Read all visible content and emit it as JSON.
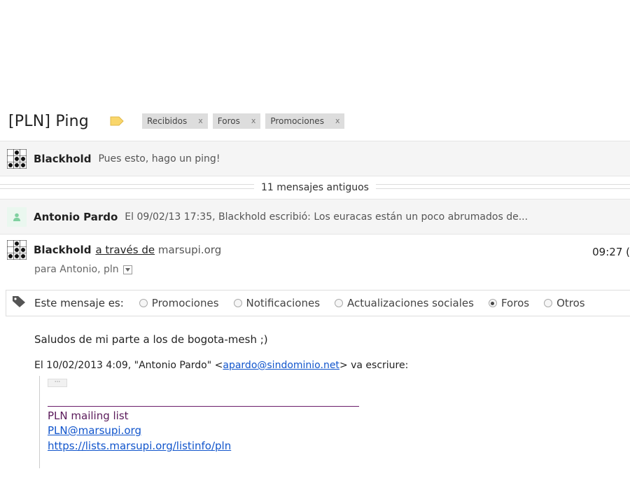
{
  "subject": {
    "title": "[PLN] Ping",
    "label_color": "#f9d66b",
    "labels": [
      {
        "name": "Recibidos",
        "remove": "x"
      },
      {
        "name": "Foros",
        "remove": "x"
      },
      {
        "name": "Promociones",
        "remove": "x"
      }
    ]
  },
  "messages": {
    "first": {
      "sender": "Blackhold",
      "snippet": "Pues esto, hago un ping!"
    },
    "older_count_text": "11 mensajes antiguos",
    "second": {
      "sender": "Antonio Pardo",
      "snippet": "El 09/02/13 17:35, Blackhold escribió: Los euracas están un poco abrumados de..."
    },
    "expanded": {
      "sender": "Blackhold",
      "via_text": "a través de",
      "via_domain": "marsupi.org",
      "time": "09:27 (",
      "recipients": "para Antonio, pln"
    }
  },
  "category_bar": {
    "label": "Este mensaje es:",
    "options": [
      {
        "label": "Promociones",
        "checked": false
      },
      {
        "label": "Notificaciones",
        "checked": false
      },
      {
        "label": "Actualizaciones sociales",
        "checked": false
      },
      {
        "label": "Foros",
        "checked": true
      },
      {
        "label": "Otros",
        "checked": false
      }
    ]
  },
  "body": {
    "line1": "Saludos de mi parte a los de bogota-mesh ;)",
    "quote_prefix": "El 10/02/2013 4:09, \"Antonio Pardo\" <",
    "quote_email": "apardo@sindominio.net",
    "quote_suffix": "> va escriure:",
    "ellipsis": "···",
    "mailing_list_title": "PLN mailing list",
    "mailing_list_email": "PLN@marsupi.org",
    "mailing_list_url": "https://lists.marsupi.org/listinfo/pln"
  }
}
